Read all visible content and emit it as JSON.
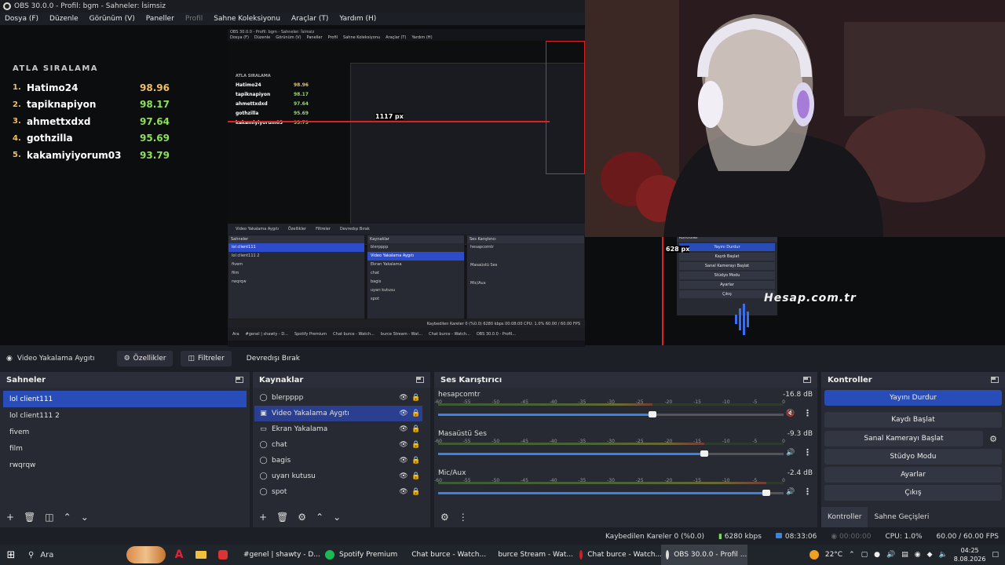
{
  "window": {
    "title": "OBS 30.0.0 - Profil: bgm - Sahneler: İsimsiz"
  },
  "menu": [
    "Dosya (F)",
    "Düzenle",
    "Görünüm (V)",
    "Paneller",
    "Profil",
    "Sahne Koleksiyonu",
    "Araçlar (T)",
    "Yardım (H)"
  ],
  "leaderboard": {
    "title": "ATLA SIRALAMA",
    "rows": [
      {
        "rank": "1.",
        "name": "Hatimo24",
        "score": "98.96",
        "color": "#f0c060"
      },
      {
        "rank": "2.",
        "name": "tapiknapiyon",
        "score": "98.17",
        "color": "#8ee05a"
      },
      {
        "rank": "3.",
        "name": "ahmettxdxd",
        "score": "97.64",
        "color": "#8ee05a"
      },
      {
        "rank": "4.",
        "name": "gothzilla",
        "score": "95.69",
        "color": "#8ee05a"
      },
      {
        "rank": "5.",
        "name": "kakamiyiyorum03",
        "score": "93.79",
        "color": "#8ee05a"
      }
    ]
  },
  "inner_preview": {
    "title": "OBS 30.0.0 - Profil: bgm - Sahneler: İsimsiz",
    "menu": [
      "Dosya (F)",
      "Düzenle",
      "Görünüm (V)",
      "Paneller",
      "Profil",
      "Sahne Koleksiyonu",
      "Araçlar (T)",
      "Yardım (H)"
    ],
    "px_label_1": "1117 px",
    "px_label_2": "628 px",
    "props": [
      "Video Yakalama Aygıtı",
      "Özellikler",
      "Filtreler",
      "Devredışı Bırak"
    ],
    "scenes_header": "Sahneler",
    "scenes": [
      "lol client111",
      "lol client111 2",
      "fivem",
      "film",
      "rwqrqw"
    ],
    "sources_header": "Kaynaklar",
    "sources": [
      "blerpppp",
      "Video Yakalama Aygıtı",
      "Ekran Yakalama",
      "chat",
      "bagis",
      "uyarı kutusu",
      "spot"
    ],
    "mixer_header": "Ses Karıştırıcı",
    "mixer": [
      "hesapcomtr",
      "Masaüstü Ses",
      "Mic/Aux"
    ],
    "controls_header": "Kontroller",
    "controls": [
      "Yayını Durdur",
      "Kaydı Başlat",
      "Sanal Kamerayı Başlat",
      "Stüdyo Modu",
      "Ayarlar",
      "Çıkış"
    ],
    "status": "Kaybedilen Kareler 0 (%0.0)   6280 kbps   00:08:00   CPU: 1.0%   60.00 / 60.00 FPS",
    "taskbar": [
      "Ara",
      "#genel | shawty - D...",
      "Spotify Premium",
      "Chat burce - Watch...",
      "burce Stream - Wat...",
      "Chat burce - Watch...",
      "OBS 30.0.0 - Profil..."
    ]
  },
  "watermark": "Hesap.com.tr",
  "source_toolbar": {
    "name": "Video Yakalama Aygıtı",
    "properties": "Özellikler",
    "filters": "Filtreler",
    "deactivate": "Devredışı Bırak"
  },
  "scenes": {
    "header": "Sahneler",
    "items": [
      "lol client111",
      "lol client111 2",
      "fivem",
      "film",
      "rwqrqw"
    ],
    "selected": 0
  },
  "sources": {
    "header": "Kaynaklar",
    "items": [
      {
        "name": "blerpppp",
        "icon": "globe-icon"
      },
      {
        "name": "Video Yakalama Aygıtı",
        "icon": "camera-icon"
      },
      {
        "name": "Ekran Yakalama",
        "icon": "monitor-icon"
      },
      {
        "name": "chat",
        "icon": "globe-icon"
      },
      {
        "name": "bagis",
        "icon": "globe-icon"
      },
      {
        "name": "uyarı kutusu",
        "icon": "globe-icon"
      },
      {
        "name": "spot",
        "icon": "globe-icon"
      }
    ],
    "selected": 1
  },
  "mixer": {
    "header": "Ses Karıştırıcı",
    "ticks": [
      "-60",
      "-55",
      "-50",
      "-45",
      "-40",
      "-35",
      "-30",
      "-25",
      "-20",
      "-15",
      "-10",
      "-5",
      "0"
    ],
    "channels": [
      {
        "name": "hesapcomtr",
        "db": "-16.8 dB",
        "level": 0.62,
        "muted": true
      },
      {
        "name": "Masaüstü Ses",
        "db": "-9.3 dB",
        "level": 0.77,
        "muted": false
      },
      {
        "name": "Mic/Aux",
        "db": "-2.4 dB",
        "level": 0.95,
        "muted": false
      }
    ]
  },
  "controls": {
    "header": "Kontroller",
    "buttons": [
      "Yayını Durdur",
      "Kaydı Başlat",
      "Sanal Kamerayı Başlat",
      "Stüdyo Modu",
      "Ayarlar",
      "Çıkış"
    ],
    "tabs": [
      "Kontroller",
      "Sahne Geçişleri"
    ]
  },
  "status": {
    "dropped": "Kaybedilen Kareler 0 (%0.0)",
    "bitrate": "6280 kbps",
    "stream_time": "08:33:06",
    "rec_time": "00:00:00",
    "cpu": "CPU: 1.0%",
    "fps": "60.00 / 60.00 FPS"
  },
  "taskbar": {
    "search": "Ara",
    "apps": [
      {
        "label": "#genel | shawty - D...",
        "color": "#5865f2"
      },
      {
        "label": "Spotify Premium",
        "color": "#1db954"
      },
      {
        "label": "Chat burce - Watch...",
        "color": "#4285f4"
      },
      {
        "label": "burce Stream - Wat...",
        "color": "#4285f4"
      },
      {
        "label": "Chat burce - Watch...",
        "color": "#cc2222"
      },
      {
        "label": "OBS 30.0.0 - Profil ...",
        "color": "#222222"
      }
    ],
    "weather": "22°C",
    "time": "04:25",
    "date": "8.08.2026"
  }
}
